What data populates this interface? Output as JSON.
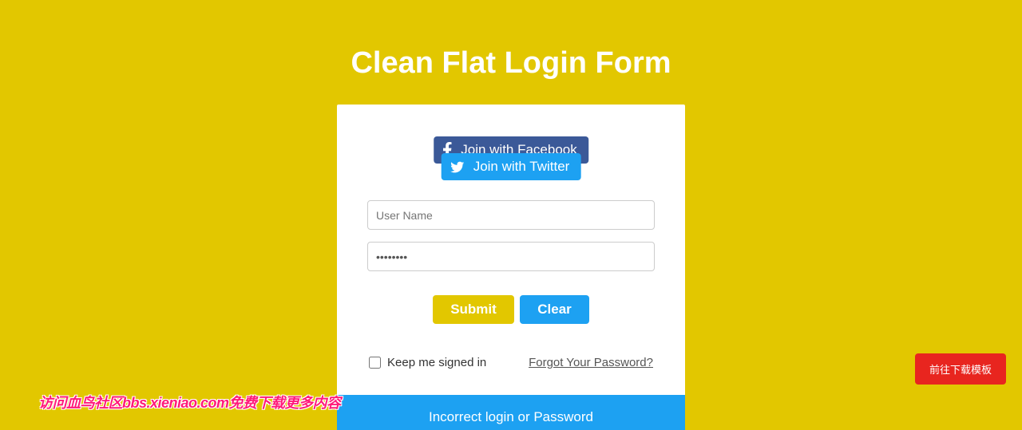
{
  "title": "Clean Flat Login Form",
  "social": {
    "facebook_label": "Join with Facebook",
    "twitter_label": "Join with Twitter"
  },
  "form": {
    "username_placeholder": "User Name",
    "username_value": "",
    "password_value": "••••••••",
    "submit_label": "Submit",
    "clear_label": "Clear",
    "keep_signed_label": "Keep me signed in",
    "forgot_label": "Forgot Your Password?"
  },
  "error_message": "Incorrect login or Password",
  "float_button": "前往下载模板",
  "watermark": "访问血鸟社区bbs.xieniao.com免费下载更多内容"
}
